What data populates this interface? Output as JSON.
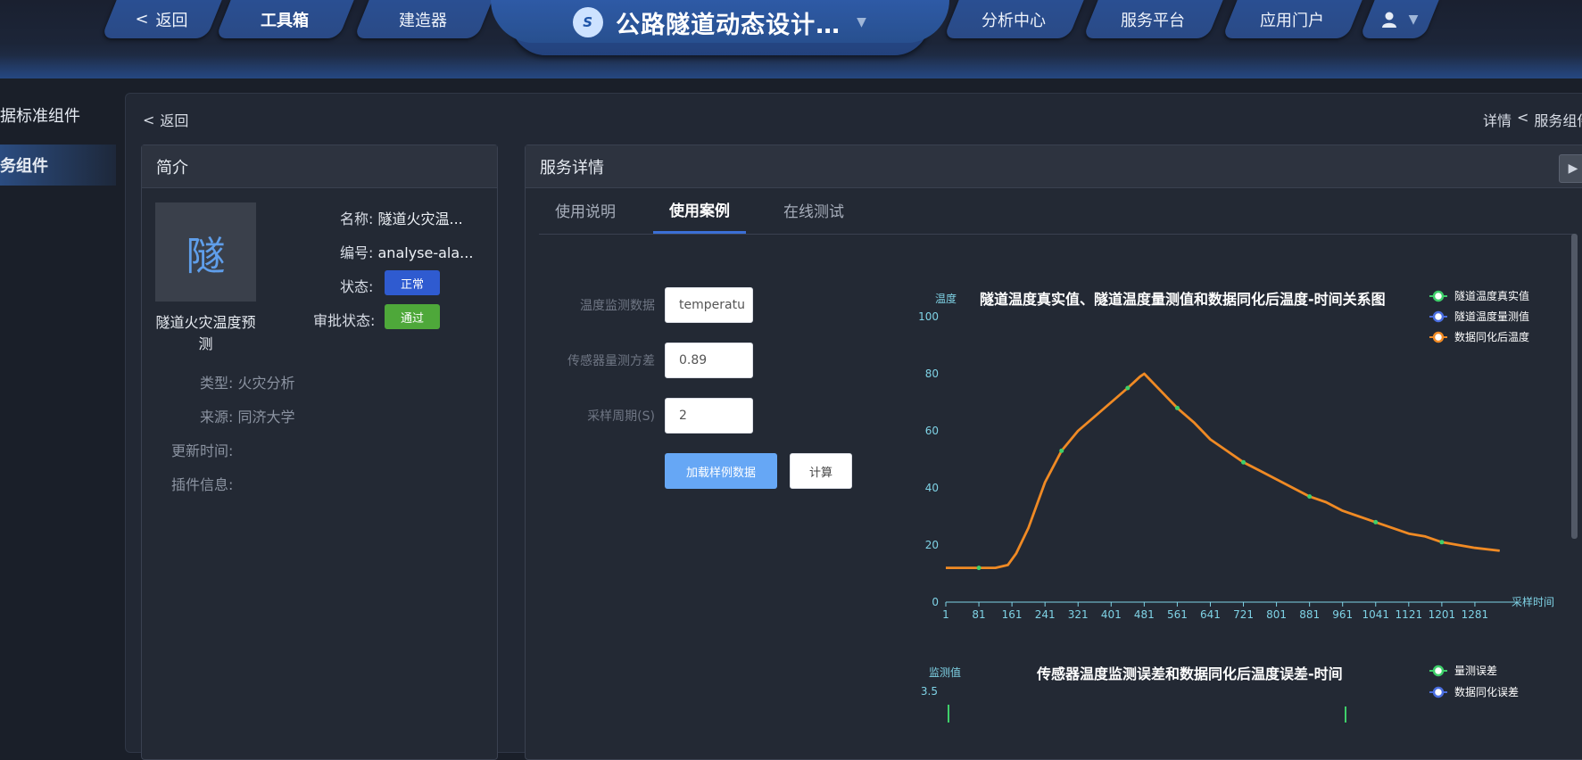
{
  "nav": {
    "back": "返回",
    "toolbox": "工具箱",
    "builder": "建造器",
    "app_title": "公路隧道动态设计…",
    "logo_glyph": "S",
    "analysis": "分析中心",
    "service": "服务平台",
    "portal": "应用门户",
    "user_icon": "user-icon"
  },
  "sidebar": {
    "items": [
      {
        "label": "据标准组件"
      },
      {
        "label": "务组件"
      }
    ]
  },
  "page": {
    "back": "返回",
    "breadcrumb_current": "详情",
    "breadcrumb_sep": "<",
    "breadcrumb_parent": "服务组件"
  },
  "intro": {
    "header": "简介",
    "avatar_char": "隧",
    "title": "隧道火灾温度预测",
    "name_label": "名称:",
    "name_value": "隧道火灾温...",
    "code_label": "编号:",
    "code_value": "analyse-ala...",
    "status_label": "状态:",
    "status_value": "正常",
    "approval_label": "审批状态:",
    "approval_value": "通过",
    "type_label": "类型:",
    "type_value": "火灾分析",
    "source_label": "来源:",
    "source_value": "同济大学",
    "update_label": "更新时间:",
    "update_value": "",
    "plugin_label": "插件信息:",
    "plugin_value": ""
  },
  "detail": {
    "header": "服务详情",
    "tabs": [
      {
        "label": "使用说明"
      },
      {
        "label": "使用案例"
      },
      {
        "label": "在线测试"
      }
    ],
    "active_tab": 1,
    "form": {
      "temp_label": "温度监测数据",
      "temp_value": "temperatu",
      "variance_label": "传感器量测方差",
      "variance_value": "0.89",
      "period_label": "采样周期(S)",
      "period_value": "2",
      "load_button": "加载样例数据",
      "calc_button": "计算"
    }
  },
  "colors": {
    "accent": "#3b6fd6",
    "status_normal": "#2f5bd0",
    "status_pass": "#4ea83a",
    "series_true": "#3ecf6a",
    "series_measured": "#4a6ee0",
    "series_assim": "#f08a24",
    "axis": "#7fd3e6"
  },
  "chart_data": [
    {
      "type": "line",
      "title": "隧道温度真实值、隧道温度量测值和数据同化后温度-时间关系图",
      "ylabel": "温度",
      "xlabel": "采样时间",
      "ylim": [
        0,
        100
      ],
      "yticks": [
        0,
        20,
        40,
        60,
        80,
        100
      ],
      "xticks": [
        1,
        81,
        161,
        241,
        321,
        401,
        481,
        561,
        641,
        721,
        801,
        881,
        961,
        1041,
        1121,
        1201,
        1281
      ],
      "legend_position": "top-right",
      "legend": [
        "隧道温度真实值",
        "隧道温度量测值",
        "数据同化后温度"
      ],
      "x": [
        1,
        41,
        81,
        121,
        151,
        171,
        201,
        241,
        281,
        321,
        361,
        401,
        441,
        471,
        481,
        521,
        561,
        601,
        641,
        681,
        721,
        761,
        801,
        841,
        881,
        921,
        961,
        1001,
        1041,
        1081,
        1121,
        1161,
        1201,
        1241,
        1281,
        1341
      ],
      "series": [
        {
          "name": "隧道温度真实值",
          "values": [
            12,
            12,
            12,
            12,
            13,
            17,
            26,
            42,
            53,
            60,
            65,
            70,
            75,
            79,
            80,
            74,
            68,
            63,
            57,
            53,
            49,
            46,
            43,
            40,
            37,
            35,
            32,
            30,
            28,
            26,
            24,
            23,
            21,
            20,
            19,
            18
          ]
        },
        {
          "name": "隧道温度量测值",
          "values": [
            12,
            12,
            12,
            12,
            13,
            17,
            26,
            42,
            53,
            60,
            65,
            70,
            75,
            79,
            80,
            74,
            68,
            63,
            57,
            53,
            49,
            46,
            43,
            40,
            37,
            35,
            32,
            30,
            28,
            26,
            24,
            23,
            21,
            20,
            19,
            18
          ]
        },
        {
          "name": "数据同化后温度",
          "values": [
            12,
            12,
            12,
            12,
            13,
            17,
            26,
            42,
            53,
            60,
            65,
            70,
            75,
            79,
            80,
            74,
            68,
            63,
            57,
            53,
            49,
            46,
            43,
            40,
            37,
            35,
            32,
            30,
            28,
            26,
            24,
            23,
            21,
            20,
            19,
            18
          ]
        }
      ]
    },
    {
      "type": "line",
      "title": "传感器温度监测误差和数据同化后温度误差-时间",
      "ylabel": "监测值",
      "yticks": [
        3.5
      ],
      "legend_position": "top-right",
      "legend": [
        "量测误差",
        "数据同化误差"
      ],
      "series": [
        {
          "name": "量测误差",
          "values": []
        },
        {
          "name": "数据同化误差",
          "values": []
        }
      ]
    }
  ]
}
